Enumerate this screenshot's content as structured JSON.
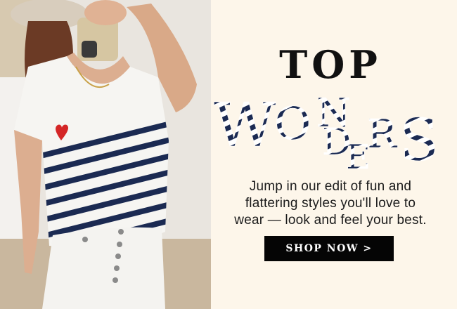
{
  "banner": {
    "headline_top": "TOP",
    "headline_word": "WONDERS",
    "headline_letters": [
      "W",
      "O",
      "N",
      "D",
      "E",
      "R",
      "S"
    ],
    "blurb_lines": [
      "Jump in our edit of fun and",
      "flattering styles you'll love to",
      "wear — look and feel your best."
    ],
    "cta_label": "SHOP NOW >"
  },
  "colors": {
    "background": "#fdf6ea",
    "headline": "#111111",
    "stripe_navy": "#1b2a52",
    "button_bg": "#050505",
    "button_text": "#ffffff"
  },
  "image": {
    "subject": "Woman in white striped V-neck tee with heart patch and white button-fly jeans taking a mirror selfie"
  }
}
